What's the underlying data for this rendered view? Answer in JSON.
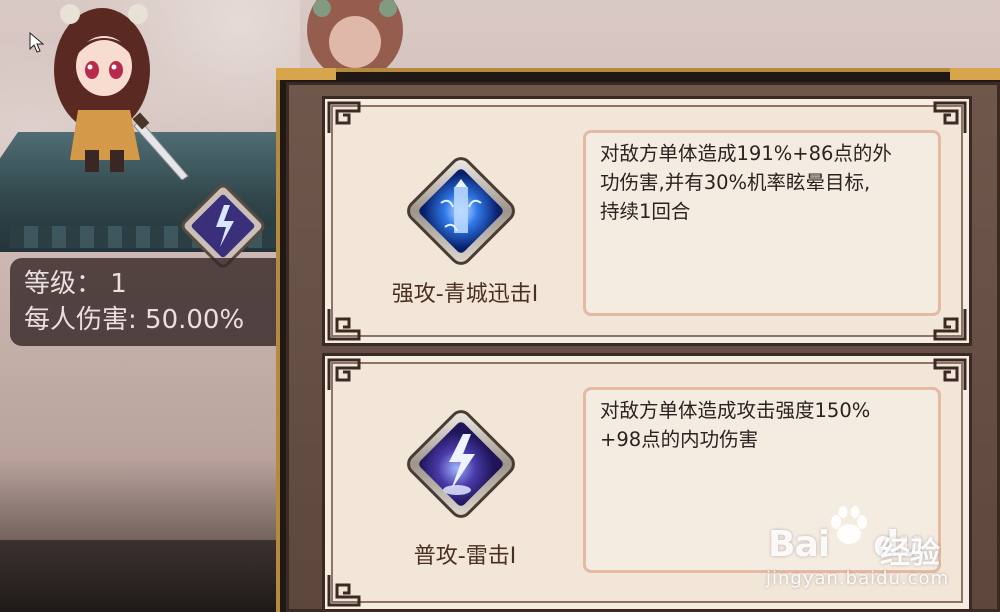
{
  "background": {
    "stats": {
      "level_label": "等级：",
      "level_value": "1",
      "damage_label": "每人伤害:",
      "damage_value": "50.00%"
    }
  },
  "skills": [
    {
      "name": "强攻-青城迅击I",
      "icon": "blue-crystal-skill-icon",
      "description_lines": [
        "对敌方单体造成191%+86点的外",
        "功伤害,并有30%机率眩晕目标,",
        "持续1回合"
      ]
    },
    {
      "name": "普攻-雷击I",
      "icon": "purple-lightning-skill-icon",
      "description_lines": [
        "对敌方单体造成攻击强度150%",
        "+98点的内功伤害"
      ]
    }
  ],
  "watermark": {
    "logo_text": "Bai",
    "logo_text_2": "du",
    "brand": "经验",
    "url": "jingyan.baidu.com"
  },
  "colors": {
    "frame_gold": "#d7a64a",
    "card_bg": "#f2e6d8",
    "desc_border": "#e5b9a3",
    "skill_name": "#4a2f22"
  }
}
